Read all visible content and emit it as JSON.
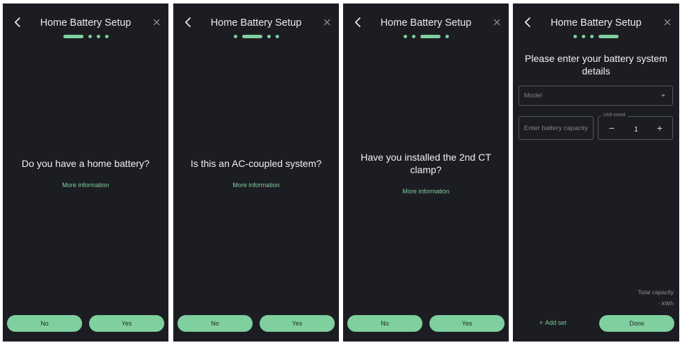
{
  "colors": {
    "background": "#1c1d22",
    "accent": "#7fcf9f",
    "text": "#e9e9ea",
    "field_border": "#55575e"
  },
  "header": {
    "title": "Home Battery Setup",
    "back_icon": "chevron-left-icon",
    "close_icon": "close-icon",
    "total_steps": 4
  },
  "screens": [
    {
      "active_step": 1,
      "question": "Do you have a home battery?",
      "more_info": "More information",
      "no_label": "No",
      "yes_label": "Yes"
    },
    {
      "active_step": 2,
      "question": "Is this an AC-coupled system?",
      "more_info": "More information",
      "no_label": "No",
      "yes_label": "Yes"
    },
    {
      "active_step": 3,
      "question": "Have you installed the 2nd CT clamp?",
      "more_info": "More information",
      "no_label": "No",
      "yes_label": "Yes"
    },
    {
      "active_step": 4,
      "heading": "Please enter your battery system details",
      "model_placeholder": "Model",
      "capacity_placeholder": "Enter battery capacity",
      "unit_count_label": "Unit count",
      "unit_count_value": "1",
      "minus_symbol": "−",
      "plus_symbol": "+",
      "total_capacity_label": "Total capacity",
      "total_capacity_value": "- kWh",
      "add_set_label": "Add set",
      "add_set_icon": "plus-icon",
      "done_label": "Done"
    }
  ]
}
